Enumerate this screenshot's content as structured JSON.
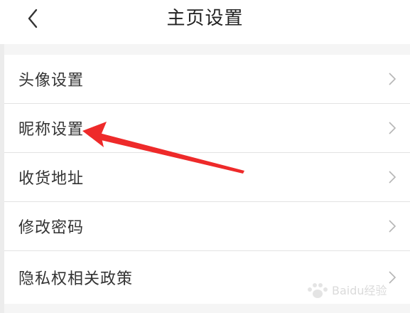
{
  "header": {
    "title": "主页设置",
    "back_icon": "chevron-left-icon"
  },
  "menu": {
    "items": [
      {
        "label": "头像设置"
      },
      {
        "label": "昵称设置"
      },
      {
        "label": "收货地址"
      },
      {
        "label": "修改密码"
      },
      {
        "label": "隐私权相关政策"
      }
    ],
    "chevron_icon": "chevron-right-icon"
  },
  "annotation": {
    "type": "red-arrow",
    "points_to": "昵称设置",
    "color": "#ee2a2a"
  },
  "watermark": {
    "text": "Baidu经验",
    "color": "#cfcfcf"
  },
  "colors": {
    "background": "#f5f5f5",
    "surface": "#ffffff",
    "text": "#333333",
    "divider": "#e3e3e3",
    "chevron": "#b5b5b5"
  }
}
